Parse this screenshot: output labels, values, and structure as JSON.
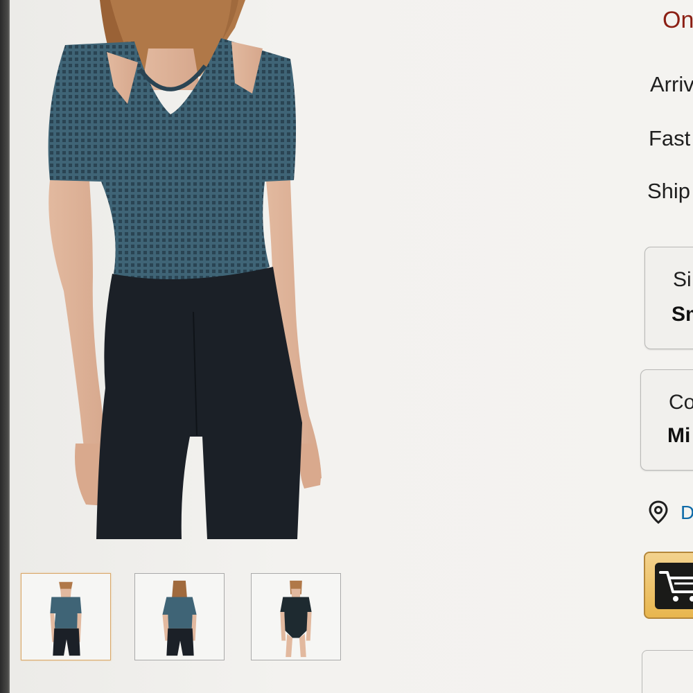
{
  "delivery": {
    "headline": "On",
    "arrives": "Arriv",
    "fast": "Fast",
    "ships": "Ship"
  },
  "options": {
    "size_label": "Si",
    "size_value": "Sm",
    "color_label": "Co",
    "color_value": "Mi"
  },
  "deliver_to": "De",
  "icons": {
    "location": "location-pin-icon",
    "cart": "shopping-cart-icon"
  },
  "thumbnails": [
    {
      "view": "front",
      "selected": true
    },
    {
      "view": "back",
      "selected": false
    },
    {
      "view": "bodysuit-front",
      "selected": false
    }
  ],
  "colors": {
    "headline": "#8b1f14",
    "link": "#0e6aa8",
    "cart_button": "#e8b64e",
    "top_fabric": "#3f6476",
    "pants": "#1b2027"
  }
}
